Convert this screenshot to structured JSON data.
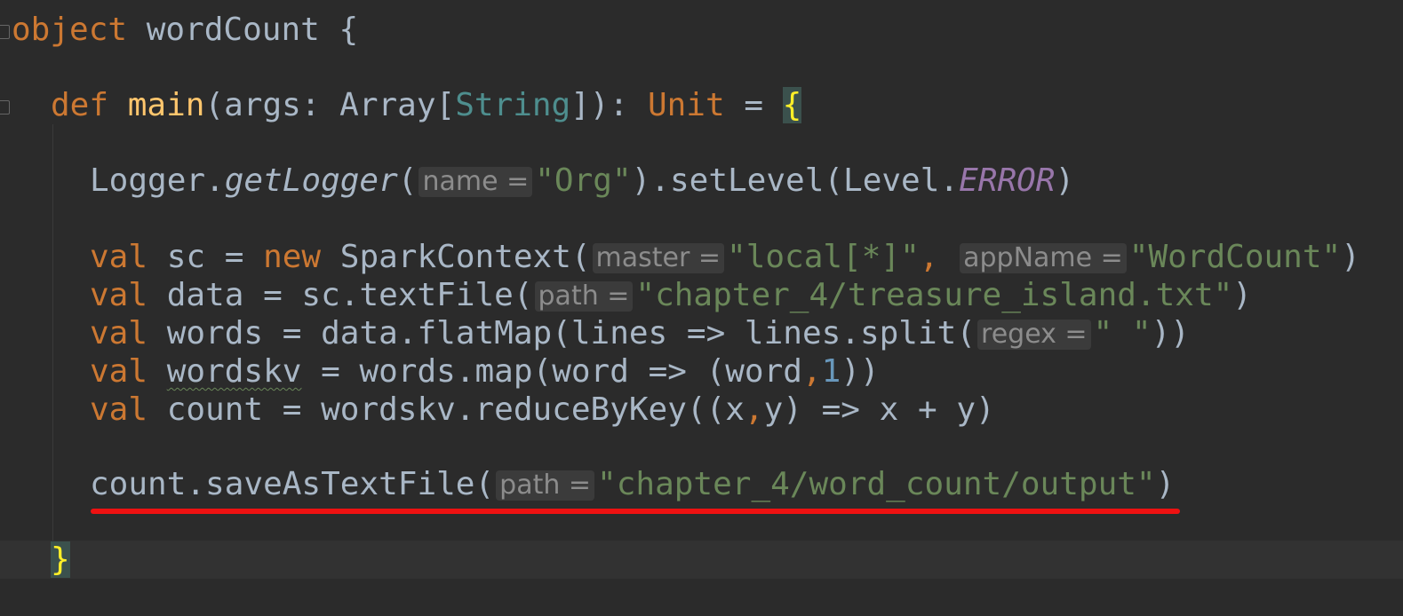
{
  "code": {
    "l1": {
      "kw": "object",
      "name": " wordCount {"
    },
    "l2": {
      "kw": "def",
      "fn": "main",
      "p1": "(args: Array[",
      "type": "String",
      "p2": "]): ",
      "ret": "Unit",
      "p3": " = ",
      "brace": "{"
    },
    "l3": {
      "a": "Logger.",
      "b": "getLogger",
      "c": "(",
      "hint": "name =",
      "str": "\"Org\"",
      "d": ").setLevel(Level.",
      "e": "ERROR",
      "f": ")"
    },
    "l4": {
      "kw1": "val",
      "a": " sc = ",
      "kw2": "new",
      "b": " SparkContext(",
      "hint1": "master =",
      "str1": "\"local[*]\"",
      "comma": ", ",
      "hint2": "appName =",
      "str2": "\"WordCount\"",
      "c": ")"
    },
    "l5": {
      "kw": "val",
      "a": " data = sc.textFile(",
      "hint": "path =",
      "str": "\"chapter_4/treasure_island.txt\"",
      "b": ")"
    },
    "l6": {
      "kw": "val",
      "a": " words = data.flatMap(lines => lines.split(",
      "hint": "regex =",
      "str": "\" \"",
      "b": "))"
    },
    "l7": {
      "kw": "val",
      "sp": " ",
      "var": "wordskv",
      "a": " = words.map(word => (word",
      "comma": ",",
      "num": "1",
      "b": "))"
    },
    "l8": {
      "kw": "val",
      "a": " count = wordskv.reduceByKey((x",
      "comma": ",",
      "b": "y) => x + y)"
    },
    "l9": {
      "a": "count.saveAsTextFile(",
      "hint": "path =",
      "str": "\"chapter_4/word_count/output\"",
      "b": ")"
    },
    "l10": {
      "brace": "}"
    }
  },
  "colors": {
    "background": "#2b2b2b",
    "keyword": "#cc7832",
    "function": "#ffc66d",
    "string": "#6a8759",
    "number": "#6897bb",
    "static_field": "#9876aa",
    "annotation_underline": "#ee1111"
  },
  "icons": [
    "fold-marker-icon"
  ]
}
